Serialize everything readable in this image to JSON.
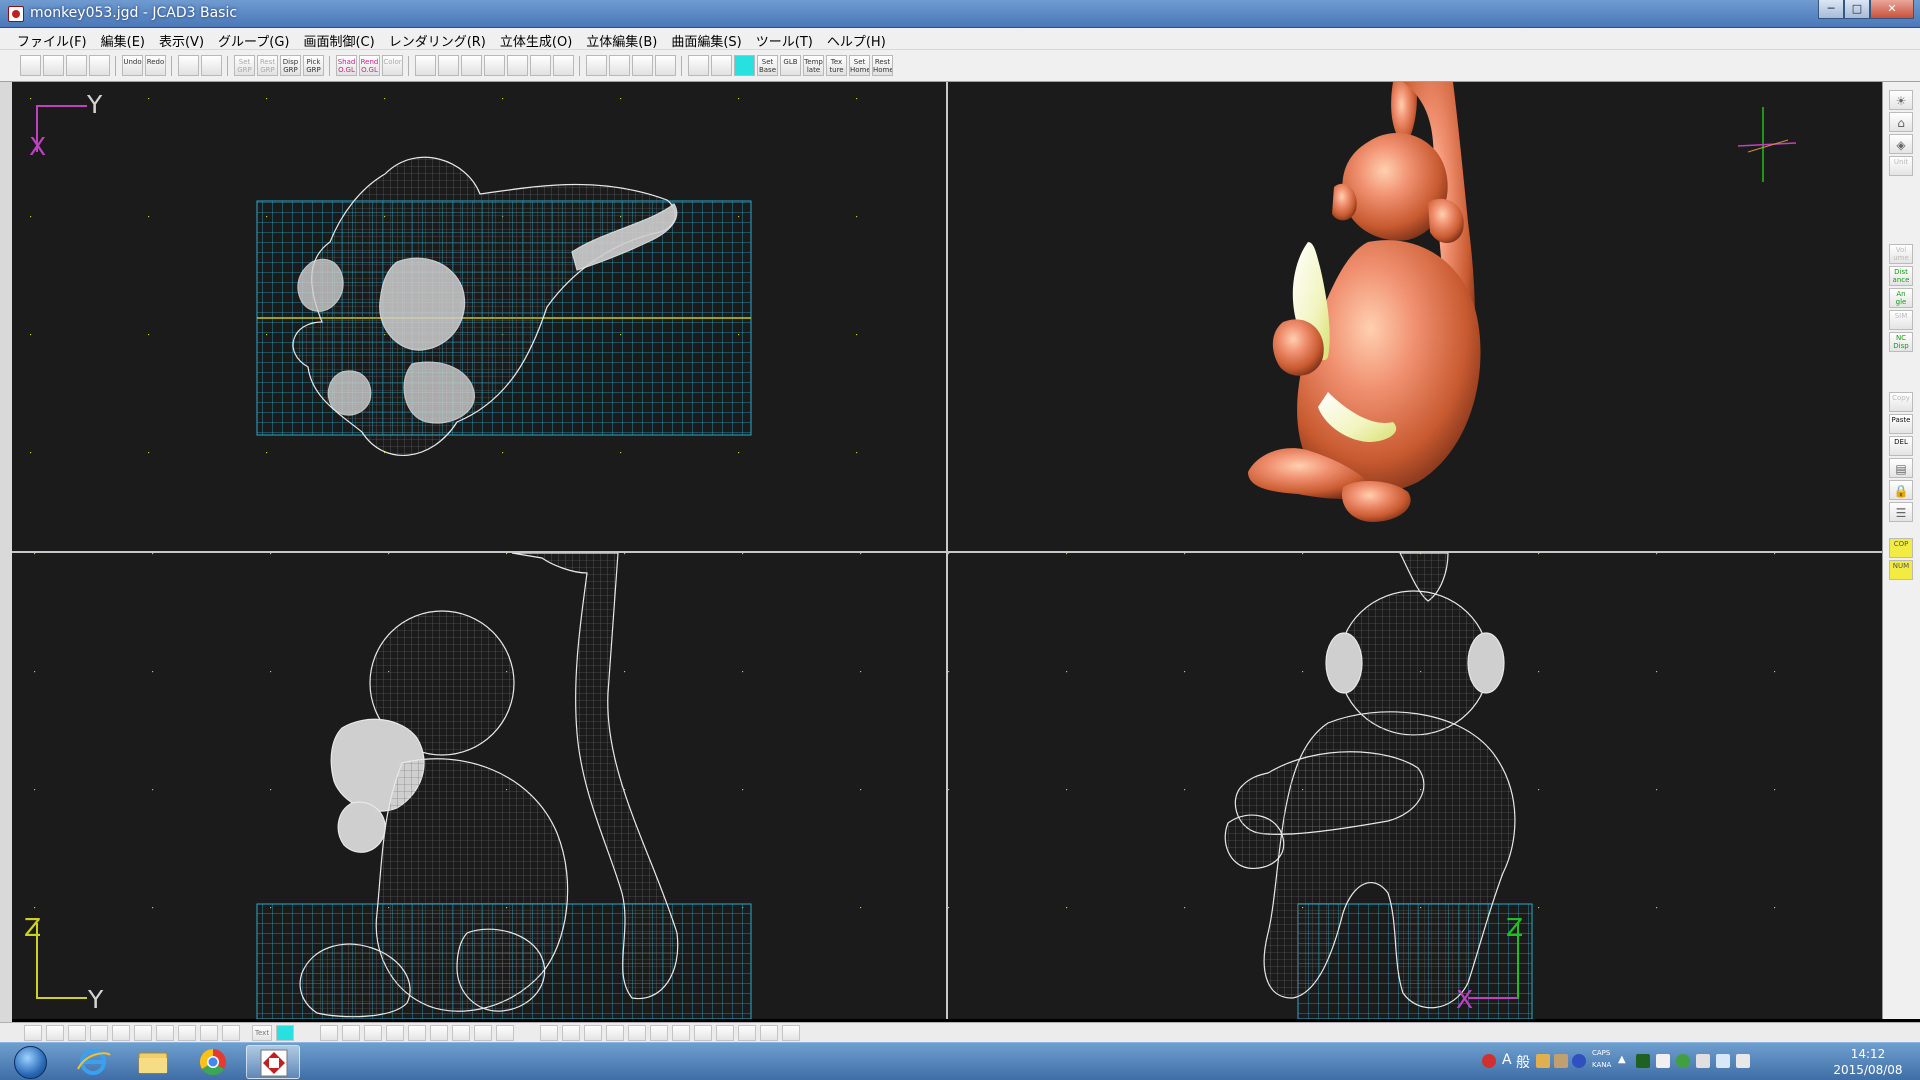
{
  "window": {
    "title": "monkey053.jgd - JCAD3 Basic",
    "controls": [
      "─",
      "□",
      "✕"
    ]
  },
  "menu": [
    "ファイル(F)",
    "編集(E)",
    "表示(V)",
    "グループ(G)",
    "画面制御(C)",
    "レンダリング(R)",
    "立体生成(O)",
    "立体編集(B)",
    "曲面編集(S)",
    "ツール(T)",
    "ヘルプ(H)"
  ],
  "toolbar": {
    "buttons": [
      {
        "name": "new-file-button",
        "label": "",
        "icon": "new-file-icon",
        "glyph": "🗋"
      },
      {
        "name": "open-file-button",
        "label": "",
        "icon": "folder-icon",
        "glyph": "📂"
      },
      {
        "name": "save-button",
        "label": "",
        "icon": "floppy-icon",
        "glyph": "💾"
      },
      {
        "name": "print-button",
        "label": "",
        "icon": "printer-icon",
        "glyph": "⎙"
      },
      {
        "name": "undo-button",
        "label": "Undo",
        "icon": "",
        "glyph": ""
      },
      {
        "name": "redo-button",
        "label": "Redo",
        "icon": "",
        "glyph": ""
      },
      {
        "name": "display-toggle-1-button",
        "label": "",
        "icon": "window-icon",
        "glyph": "▣"
      },
      {
        "name": "display-toggle-2-button",
        "label": "",
        "icon": "grid-window-icon",
        "glyph": "▦"
      },
      {
        "name": "set-grp-button",
        "label": "Set GRP",
        "icon": "",
        "glyph": ""
      },
      {
        "name": "rest-grp-button",
        "label": "Rest GRP",
        "icon": "",
        "glyph": ""
      },
      {
        "name": "disp-grp-button",
        "label": "Disp GRP",
        "icon": "",
        "glyph": ""
      },
      {
        "name": "pick-grp-button",
        "label": "Pick GRP",
        "icon": "",
        "glyph": ""
      },
      {
        "name": "shad-button",
        "label": "Shad O.GL",
        "icon": "",
        "glyph": ""
      },
      {
        "name": "rend-button",
        "label": "Rend O.GL",
        "icon": "",
        "glyph": ""
      },
      {
        "name": "color-button",
        "label": "Color",
        "icon": "",
        "glyph": ""
      },
      {
        "name": "zoom-in-button",
        "label": "",
        "icon": "zoom-in-icon",
        "glyph": "⊕"
      },
      {
        "name": "zoom-out-button",
        "label": "",
        "icon": "zoom-out-icon",
        "glyph": "⊖"
      },
      {
        "name": "zoom-window-button",
        "label": "",
        "icon": "zoom-window-icon",
        "glyph": "⊡"
      },
      {
        "name": "zoom-all-button",
        "label": "",
        "icon": "zoom-all-icon",
        "glyph": "▭"
      },
      {
        "name": "zoom-fit-button",
        "label": "",
        "icon": "zoom-fit-icon",
        "glyph": "⊞"
      },
      {
        "name": "pan-button",
        "label": "",
        "icon": "hand-icon",
        "glyph": "✋"
      },
      {
        "name": "back-button",
        "label": "",
        "icon": "back-view-icon",
        "glyph": "↶"
      },
      {
        "name": "view-zoom-in-button",
        "label": "",
        "icon": "red-zoom-in-icon",
        "glyph": "⊕"
      },
      {
        "name": "view-zoom-out-button",
        "label": "",
        "icon": "red-zoom-out-icon",
        "glyph": "⊖"
      },
      {
        "name": "view-rotate-button",
        "label": "",
        "icon": "rotate-view-icon",
        "glyph": "⟳"
      },
      {
        "name": "view-fit-button",
        "label": "",
        "icon": "fit-view-icon",
        "glyph": "⊠"
      },
      {
        "name": "grid-dots-button",
        "label": "",
        "icon": "grid-dots-icon",
        "glyph": "⠿"
      },
      {
        "name": "grid-snap-button",
        "label": "",
        "icon": "grid-snap-icon",
        "glyph": "⁙"
      },
      {
        "name": "grid-display-button",
        "label": "",
        "icon": "grid-display-icon",
        "glyph": "▦"
      },
      {
        "name": "set-base-button",
        "label": "Set Base",
        "icon": "",
        "glyph": ""
      },
      {
        "name": "glb-button",
        "label": "GLB",
        "icon": "",
        "glyph": ""
      },
      {
        "name": "template-button",
        "label": "Temp late",
        "icon": "",
        "glyph": ""
      },
      {
        "name": "texture-button",
        "label": "Tex ture",
        "icon": "",
        "glyph": ""
      },
      {
        "name": "set-home-button",
        "label": "Set Home",
        "icon": "",
        "glyph": ""
      },
      {
        "name": "rest-home-button",
        "label": "Rest Home",
        "icon": "",
        "glyph": ""
      }
    ]
  },
  "viewports": {
    "top": {
      "axis_v": "Y",
      "axis_h": "X",
      "colors": {
        "v": "#c040c0",
        "h": "#c040c0",
        "vtext": "#d4d4d4",
        "htext": "#c040c0"
      }
    },
    "perspective": {
      "axis_colors": {
        "v": "#20c020",
        "h": "#c040c0",
        "h2": "#d09040"
      }
    },
    "front": {
      "axis_v": "Z",
      "axis_h": "Y",
      "colors": {
        "v": "#d0d020",
        "h": "#d0d020",
        "vtext": "#d0d020",
        "htext": "#d4d4d4"
      }
    },
    "side": {
      "axis_v": "Z",
      "axis_h": "X",
      "colors": {
        "v": "#20c020",
        "h": "#c040c0",
        "vtext": "#20c020",
        "htext": "#c040c0"
      }
    }
  },
  "right_panel": {
    "buttons": [
      {
        "name": "light-button",
        "label": "",
        "glyph": "☀"
      },
      {
        "name": "view-button",
        "label": "",
        "glyph": "⌂"
      },
      {
        "name": "layer-button",
        "label": "",
        "glyph": "◈"
      },
      {
        "name": "unit-button",
        "label": "Unit",
        "style": "dim"
      },
      {
        "name": "vol-button",
        "label": "Vol ume",
        "style": "dim"
      },
      {
        "name": "distance-button",
        "label": "Dist ance",
        "style": "green"
      },
      {
        "name": "angle-button",
        "label": "An gle",
        "style": "green"
      },
      {
        "name": "sim-button",
        "label": "SIM",
        "style": "dim"
      },
      {
        "name": "nc-disp-button",
        "label": "NC Disp",
        "style": "green"
      },
      {
        "name": "copy-button",
        "label": "Copy",
        "style": "dim"
      },
      {
        "name": "paste-button",
        "label": "Paste",
        "style": "black"
      },
      {
        "name": "delete-button",
        "label": "DEL",
        "style": "black"
      },
      {
        "name": "properties-button",
        "label": "",
        "glyph": "▤"
      },
      {
        "name": "lock-button",
        "label": "",
        "glyph": "🔒"
      },
      {
        "name": "tree-button",
        "label": "",
        "glyph": "☰"
      },
      {
        "name": "cop-button",
        "label": "COP",
        "style": "yellow"
      },
      {
        "name": "num-button",
        "label": "NUM",
        "style": "yellow"
      }
    ]
  },
  "bottom_toolbar": {
    "text_button": "Text"
  },
  "taskbar": {
    "apps": [
      "internet-explorer",
      "file-explorer",
      "chrome",
      "jcad3"
    ],
    "ime_mode": "A",
    "ime_dict": "般",
    "caps_label": "CAPS",
    "kana_label": "KANA",
    "time": "14:12",
    "date": "2015/08/08"
  }
}
